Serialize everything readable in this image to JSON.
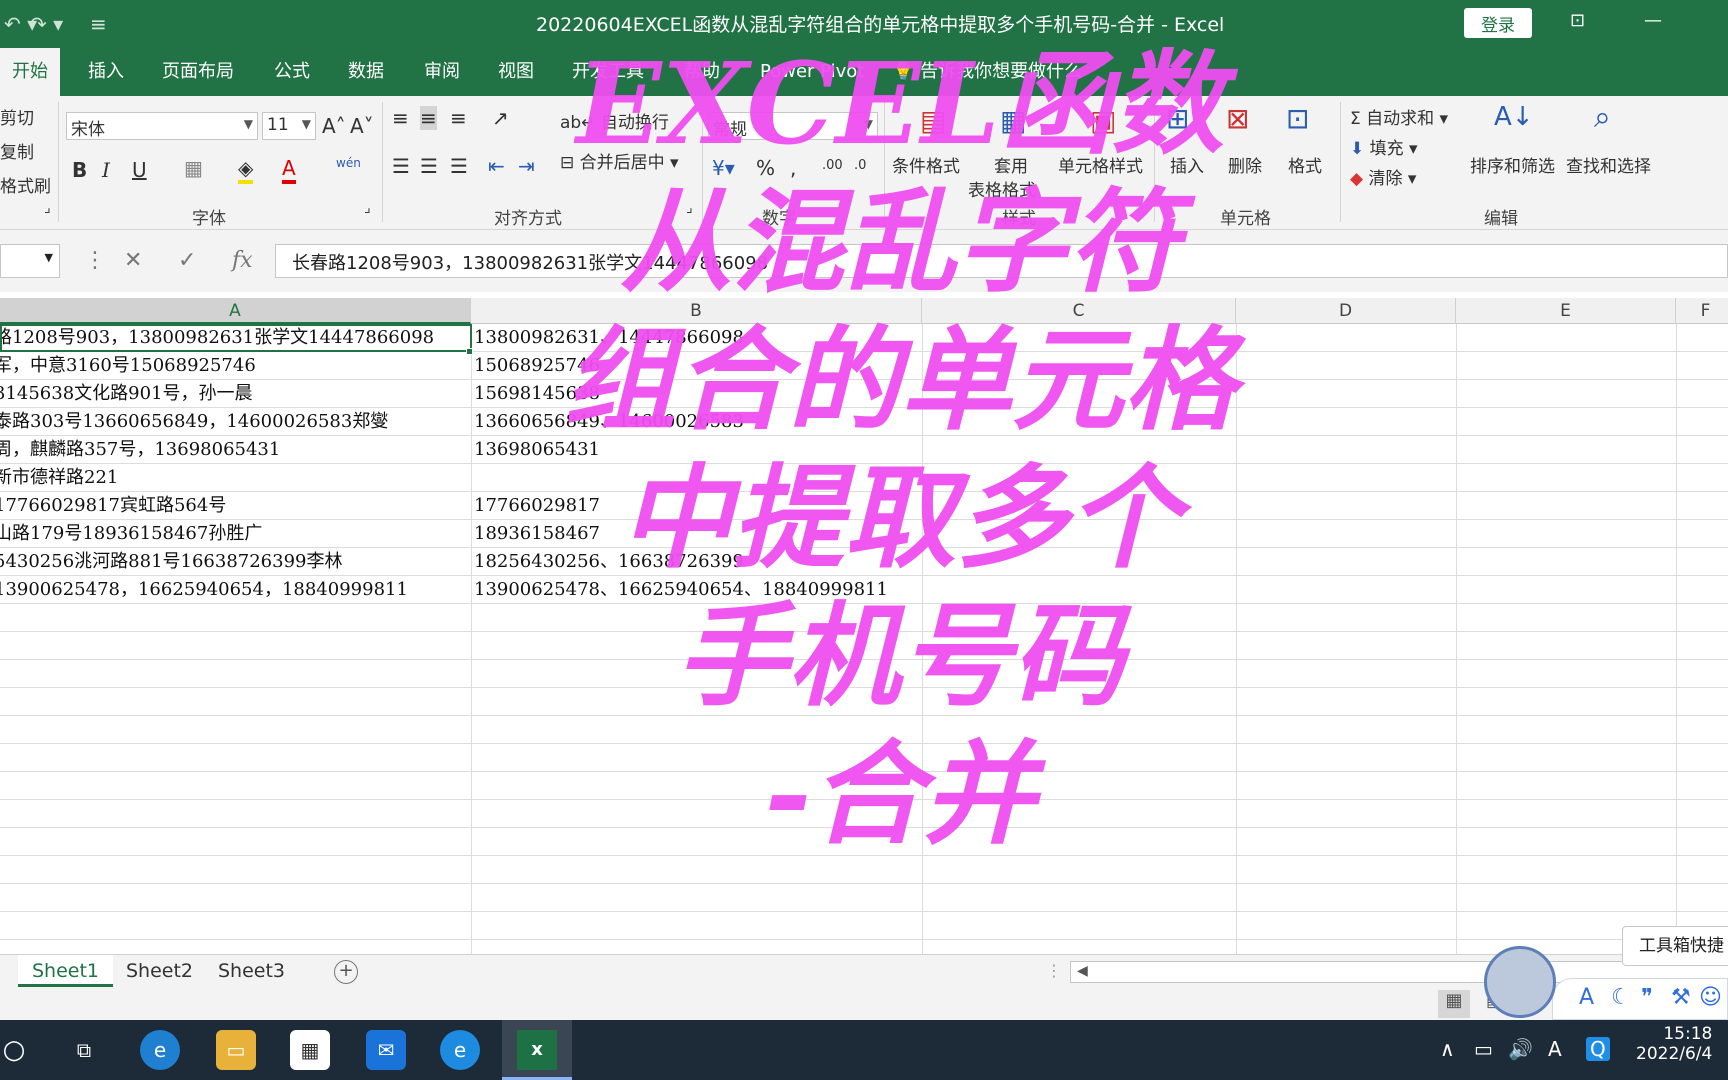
{
  "window": {
    "title": "20220604EXCEL函数从混乱字符组合的单元格中提取多个手机号码-合并  -  Excel",
    "login_label": "登录"
  },
  "ribbon": {
    "tabs": [
      "开始",
      "插入",
      "页面布局",
      "公式",
      "数据",
      "审阅",
      "视图",
      "开发工具",
      "帮助",
      "Power Pivot"
    ],
    "tell_me": "告诉我你想要做什么",
    "clipboard": {
      "cut": "剪切",
      "copy": "复制",
      "format_painter": "格式刷"
    },
    "font": {
      "name": "宋体",
      "size": "11",
      "group_label": "字体",
      "phonetic": "wén"
    },
    "alignment": {
      "wrap_text": "自动换行",
      "merge_center": "合并后居中",
      "group_label": "对齐方式"
    },
    "number": {
      "format": "常规",
      "group_label": "数字"
    },
    "styles": {
      "conditional": "条件格式",
      "table_line1": "套用",
      "table_line2": "表格格式",
      "cell_styles": "单元格样式",
      "group_label": "样式"
    },
    "cells": {
      "insert": "插入",
      "delete": "删除",
      "format": "格式",
      "group_label": "单元格"
    },
    "editing": {
      "autosum": "自动求和",
      "fill": "填充",
      "clear": "清除",
      "sort_filter": "排序和筛选",
      "find_select": "查找和选择",
      "group_label": "编辑"
    }
  },
  "formula_bar": {
    "value": "长春路1208号903，13800982631张学文14447866098"
  },
  "sheet": {
    "columns": [
      "A",
      "B",
      "C",
      "D",
      "E",
      "F"
    ],
    "rows": [
      {
        "a": "路1208号903，13800982631张学文14447866098",
        "b": "13800982631、14447866098"
      },
      {
        "a": "军，中意3160号15068925746",
        "b": "15068925746"
      },
      {
        "a": "3145638文化路901号，孙一晨",
        "b": "15698145638"
      },
      {
        "a": "泰路303号13660656849，14600026583郑燮",
        "b": "13660656849、14600026583"
      },
      {
        "a": "周，麒麟路357号，13698065431",
        "b": "13698065431"
      },
      {
        "a": "新市德祥路221",
        "b": ""
      },
      {
        "a": " 17766029817宾虹路564号",
        "b": "17766029817"
      },
      {
        "a": "山路179号18936158467孙胜广",
        "b": "18936158467"
      },
      {
        "a": "5430256洮河路881号16638726399李林",
        "b": "18256430256、16638726399"
      },
      {
        "a": " 13900625478，16625940654，18840999811",
        "b": "13900625478、16625940654、18840999811"
      },
      {
        "a": "",
        "b": ""
      },
      {
        "a": "",
        "b": ""
      },
      {
        "a": "",
        "b": ""
      },
      {
        "a": "",
        "b": ""
      },
      {
        "a": "",
        "b": ""
      },
      {
        "a": "",
        "b": ""
      },
      {
        "a": "",
        "b": ""
      },
      {
        "a": "",
        "b": ""
      },
      {
        "a": "",
        "b": ""
      },
      {
        "a": "",
        "b": ""
      },
      {
        "a": "",
        "b": ""
      },
      {
        "a": "",
        "b": ""
      }
    ],
    "tabs": [
      "Sheet1",
      "Sheet2",
      "Sheet3"
    ]
  },
  "overlay_title": [
    "EXCEL函数",
    "从混乱字符",
    "组合的单元格",
    "中提取多个",
    "手机号码",
    "-合并"
  ],
  "toolbox_tip": "工具箱快捷",
  "taskbar": {
    "time": "15:18",
    "date": "2022/6/4"
  },
  "colors": {
    "excel_green": "#217346",
    "overlay_magenta": "#ef4ff0",
    "taskbar_bg": "#1d2a38"
  }
}
